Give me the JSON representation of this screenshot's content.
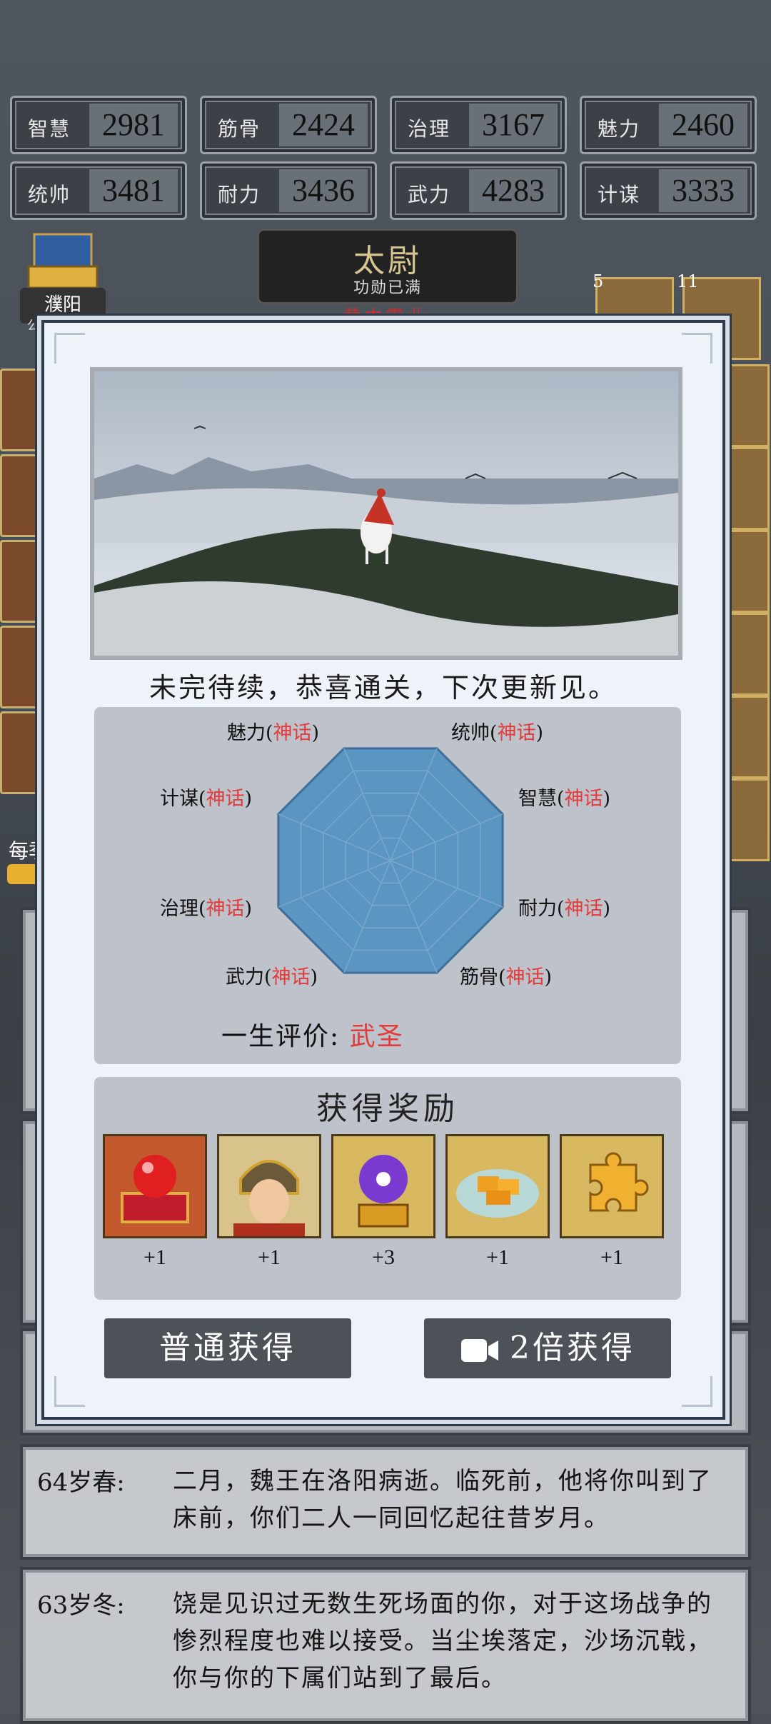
{
  "stats": [
    {
      "label": "智慧",
      "value": "2981"
    },
    {
      "label": "筋骨",
      "value": "2424"
    },
    {
      "label": "治理",
      "value": "3167"
    },
    {
      "label": "魅力",
      "value": "2460"
    },
    {
      "label": "统帅",
      "value": "3481"
    },
    {
      "label": "耐力",
      "value": "3436"
    },
    {
      "label": "武力",
      "value": "4283"
    },
    {
      "label": "计谋",
      "value": "3333"
    }
  ],
  "header": {
    "city": "濮阳",
    "city_sub": "公",
    "rank_title": "太尉",
    "rank_sub": "功勋已满",
    "rank_status": "黄巾霸业"
  },
  "right_badges": [
    "5",
    "11"
  ],
  "side_label": "每季",
  "logs": [
    {
      "age": "64岁春:",
      "text": "二月，魏王在洛阳病逝。临死前，他将你叫到了床前，你们二人一同回忆起往昔岁月。"
    },
    {
      "age": "63岁冬:",
      "text": "饶是见识过无数生死场面的你，对于这场战争的惨烈程度也难以接受。当尘埃落定，沙场沉戟，你与你的下属们站到了最后。"
    }
  ],
  "modal": {
    "summary": "未完待续，恭喜通关，下次更新见。",
    "radar_labels": [
      {
        "name": "魅力",
        "rank": "神话"
      },
      {
        "name": "统帅",
        "rank": "神话"
      },
      {
        "name": "计谋",
        "rank": "神话"
      },
      {
        "name": "智慧",
        "rank": "神话"
      },
      {
        "name": "治理",
        "rank": "神话"
      },
      {
        "name": "耐力",
        "rank": "神话"
      },
      {
        "name": "武力",
        "rank": "神话"
      },
      {
        "name": "筋骨",
        "rank": "神话"
      }
    ],
    "eval_label": "一生评价:",
    "eval_value": "武圣",
    "rewards_title": "获得奖励",
    "rewards": [
      {
        "icon": "red-orb-chest-icon",
        "count": "+1"
      },
      {
        "icon": "warrior-portrait-icon",
        "count": "+1"
      },
      {
        "icon": "purple-orb-icon",
        "count": "+3"
      },
      {
        "icon": "gold-ingots-icon",
        "count": "+1"
      },
      {
        "icon": "puzzle-piece-icon",
        "count": "+1"
      }
    ],
    "btn_normal": "普通获得",
    "btn_double": "2倍获得"
  },
  "colors": {
    "rank_red": "#e23b3b",
    "radar_fill": "#5b95c2"
  }
}
